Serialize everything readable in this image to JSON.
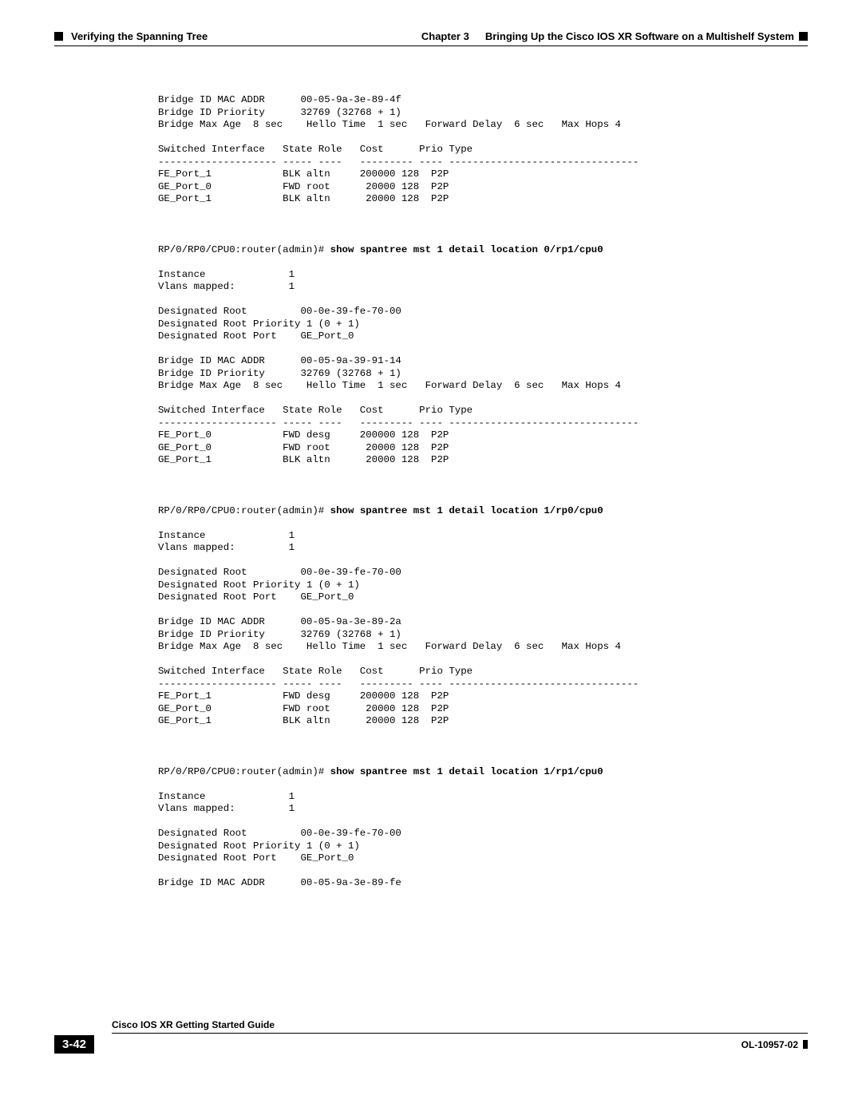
{
  "header": {
    "left": "Verifying the Spanning Tree",
    "right_chapter": "Chapter 3",
    "right_title": "Bringing Up the Cisco IOS XR Software on a Multishelf System"
  },
  "block0": "Bridge ID MAC ADDR      00-05-9a-3e-89-4f\nBridge ID Priority      32769 (32768 + 1)\nBridge Max Age  8 sec    Hello Time  1 sec   Forward Delay  6 sec   Max Hops 4\n\nSwitched Interface   State Role   Cost      Prio Type\n-------------------- ----- ----   --------- ---- --------------------------------\nFE_Port_1            BLK altn     200000 128  P2P\nGE_Port_0            FWD root      20000 128  P2P\nGE_Port_1            BLK altn      20000 128  P2P",
  "prompt1": {
    "prefix": "RP/0/RP0/CPU0:router(admin)# ",
    "cmd": "show spantree mst 1 detail location 0/rp1/cpu0"
  },
  "block1": "\nInstance              1\nVlans mapped:         1\n\nDesignated Root         00-0e-39-fe-70-00\nDesignated Root Priority 1 (0 + 1)\nDesignated Root Port    GE_Port_0\n\nBridge ID MAC ADDR      00-05-9a-39-91-14\nBridge ID Priority      32769 (32768 + 1)\nBridge Max Age  8 sec    Hello Time  1 sec   Forward Delay  6 sec   Max Hops 4\n\nSwitched Interface   State Role   Cost      Prio Type\n-------------------- ----- ----   --------- ---- --------------------------------\nFE_Port_0            FWD desg     200000 128  P2P\nGE_Port_0            FWD root      20000 128  P2P\nGE_Port_1            BLK altn      20000 128  P2P",
  "prompt2": {
    "prefix": "RP/0/RP0/CPU0:router(admin)# ",
    "cmd": "show spantree mst 1 detail location 1/rp0/cpu0"
  },
  "block2": "\nInstance              1\nVlans mapped:         1\n\nDesignated Root         00-0e-39-fe-70-00\nDesignated Root Priority 1 (0 + 1)\nDesignated Root Port    GE_Port_0\n\nBridge ID MAC ADDR      00-05-9a-3e-89-2a\nBridge ID Priority      32769 (32768 + 1)\nBridge Max Age  8 sec    Hello Time  1 sec   Forward Delay  6 sec   Max Hops 4\n\nSwitched Interface   State Role   Cost      Prio Type\n-------------------- ----- ----   --------- ---- --------------------------------\nFE_Port_1            FWD desg     200000 128  P2P\nGE_Port_0            FWD root      20000 128  P2P\nGE_Port_1            BLK altn      20000 128  P2P",
  "prompt3": {
    "prefix": "RP/0/RP0/CPU0:router(admin)# ",
    "cmd": "show spantree mst 1 detail location 1/rp1/cpu0"
  },
  "block3": "\nInstance              1\nVlans mapped:         1\n\nDesignated Root         00-0e-39-fe-70-00\nDesignated Root Priority 1 (0 + 1)\nDesignated Root Port    GE_Port_0\n\nBridge ID MAC ADDR      00-05-9a-3e-89-fe",
  "footer": {
    "title": "Cisco IOS XR Getting Started Guide",
    "page": "3-42",
    "doc": "OL-10957-02"
  }
}
